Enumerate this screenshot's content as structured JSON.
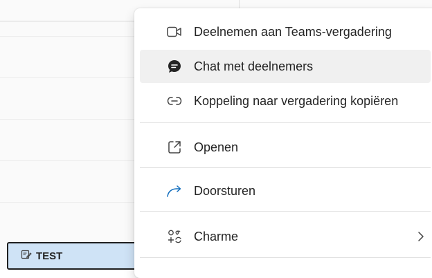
{
  "event": {
    "title": "TEST"
  },
  "menu": {
    "items": [
      {
        "label": "Deelnemen aan Teams-vergadering",
        "icon": "video-camera-icon"
      },
      {
        "label": "Chat met deelnemers",
        "icon": "chat-bubble-icon"
      },
      {
        "label": "Koppeling naar vergadering kopiëren",
        "icon": "link-icon"
      },
      {
        "label": "Openen",
        "icon": "open-external-icon"
      },
      {
        "label": "Doorsturen",
        "icon": "forward-arrow-icon"
      },
      {
        "label": "Charme",
        "icon": "charm-icon"
      }
    ]
  },
  "colors": {
    "accent": "#0f6cbd",
    "event_fill": "#cfe3f6",
    "hover": "#f0f0f0"
  }
}
